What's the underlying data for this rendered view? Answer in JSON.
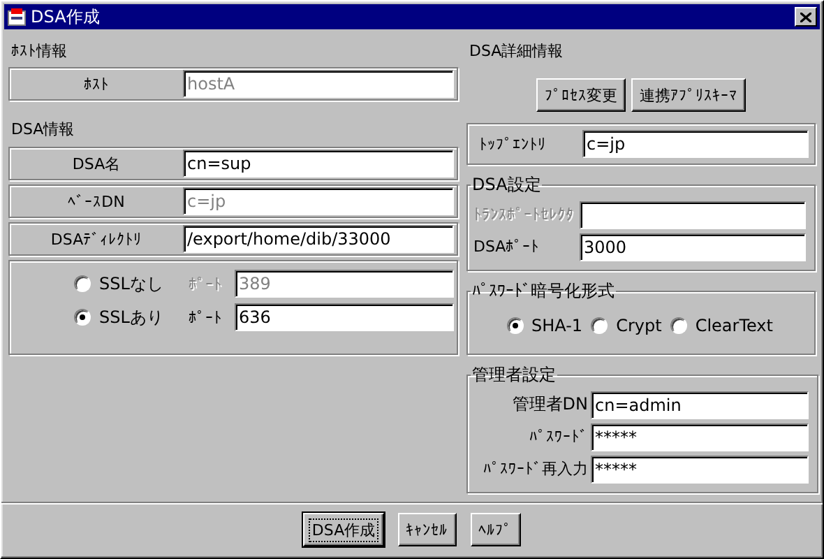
{
  "window": {
    "title": "DSA作成"
  },
  "host_section": {
    "heading": "ﾎｽﾄ情報",
    "fields": [
      {
        "label": "ﾎｽﾄ",
        "value": "hostA",
        "disabled": true
      }
    ]
  },
  "dsa_section": {
    "heading": "DSA情報",
    "fields": [
      {
        "label": "DSA名",
        "value": "cn=sup",
        "disabled": false
      },
      {
        "label": "ﾍﾞｰｽDN",
        "value": "c=jp",
        "disabled": true
      },
      {
        "label": "DSAﾃﾞｨﾚｸﾄﾘ",
        "value": "/export/home/dib/33000",
        "disabled": false
      }
    ],
    "ssl_options": [
      {
        "label": "SSLなし",
        "selected": false,
        "port_label": "ﾎﾟｰﾄ",
        "port": "389"
      },
      {
        "label": "SSLあり",
        "selected": true,
        "port_label": "ﾎﾟｰﾄ",
        "port": "636"
      }
    ]
  },
  "detail": {
    "heading": "DSA詳細情報",
    "buttons": [
      "ﾌﾟﾛｾｽ変更",
      "連携ｱﾌﾟﾘｽｷｰﾏ"
    ],
    "top_entry": {
      "label": "ﾄｯﾌﾟｴﾝﾄﾘ",
      "value": "c=jp"
    },
    "dsa_settings": {
      "title": "DSA設定",
      "fields": [
        {
          "label": "ﾄﾗﾝｽﾎﾟｰﾄｾﾚｸﾀ",
          "disabled": true
        },
        {
          "label": "DSAﾎﾟｰﾄ",
          "value": "3000",
          "disabled": false
        }
      ]
    },
    "password_format": {
      "title": "ﾊﾟｽﾜｰﾄﾞ暗号化形式",
      "options": [
        {
          "label": "SHA-1",
          "selected": true
        },
        {
          "label": "Crypt",
          "selected": false
        },
        {
          "label": "ClearText",
          "selected": false
        }
      ]
    },
    "admin": {
      "title": "管理者設定",
      "fields": [
        {
          "label": "管理者DN",
          "value": "cn=admin"
        },
        {
          "label": "ﾊﾟｽﾜｰﾄﾞ",
          "value": "*****"
        },
        {
          "label": "ﾊﾟｽﾜｰﾄﾞ再入力",
          "value": "*****"
        }
      ]
    }
  },
  "footer_buttons": [
    {
      "label": "DSA作成",
      "default": true
    },
    {
      "label": "ｷｬﾝｾﾙ",
      "default": false
    },
    {
      "label": "ﾍﾙﾌﾟ",
      "default": false
    }
  ]
}
